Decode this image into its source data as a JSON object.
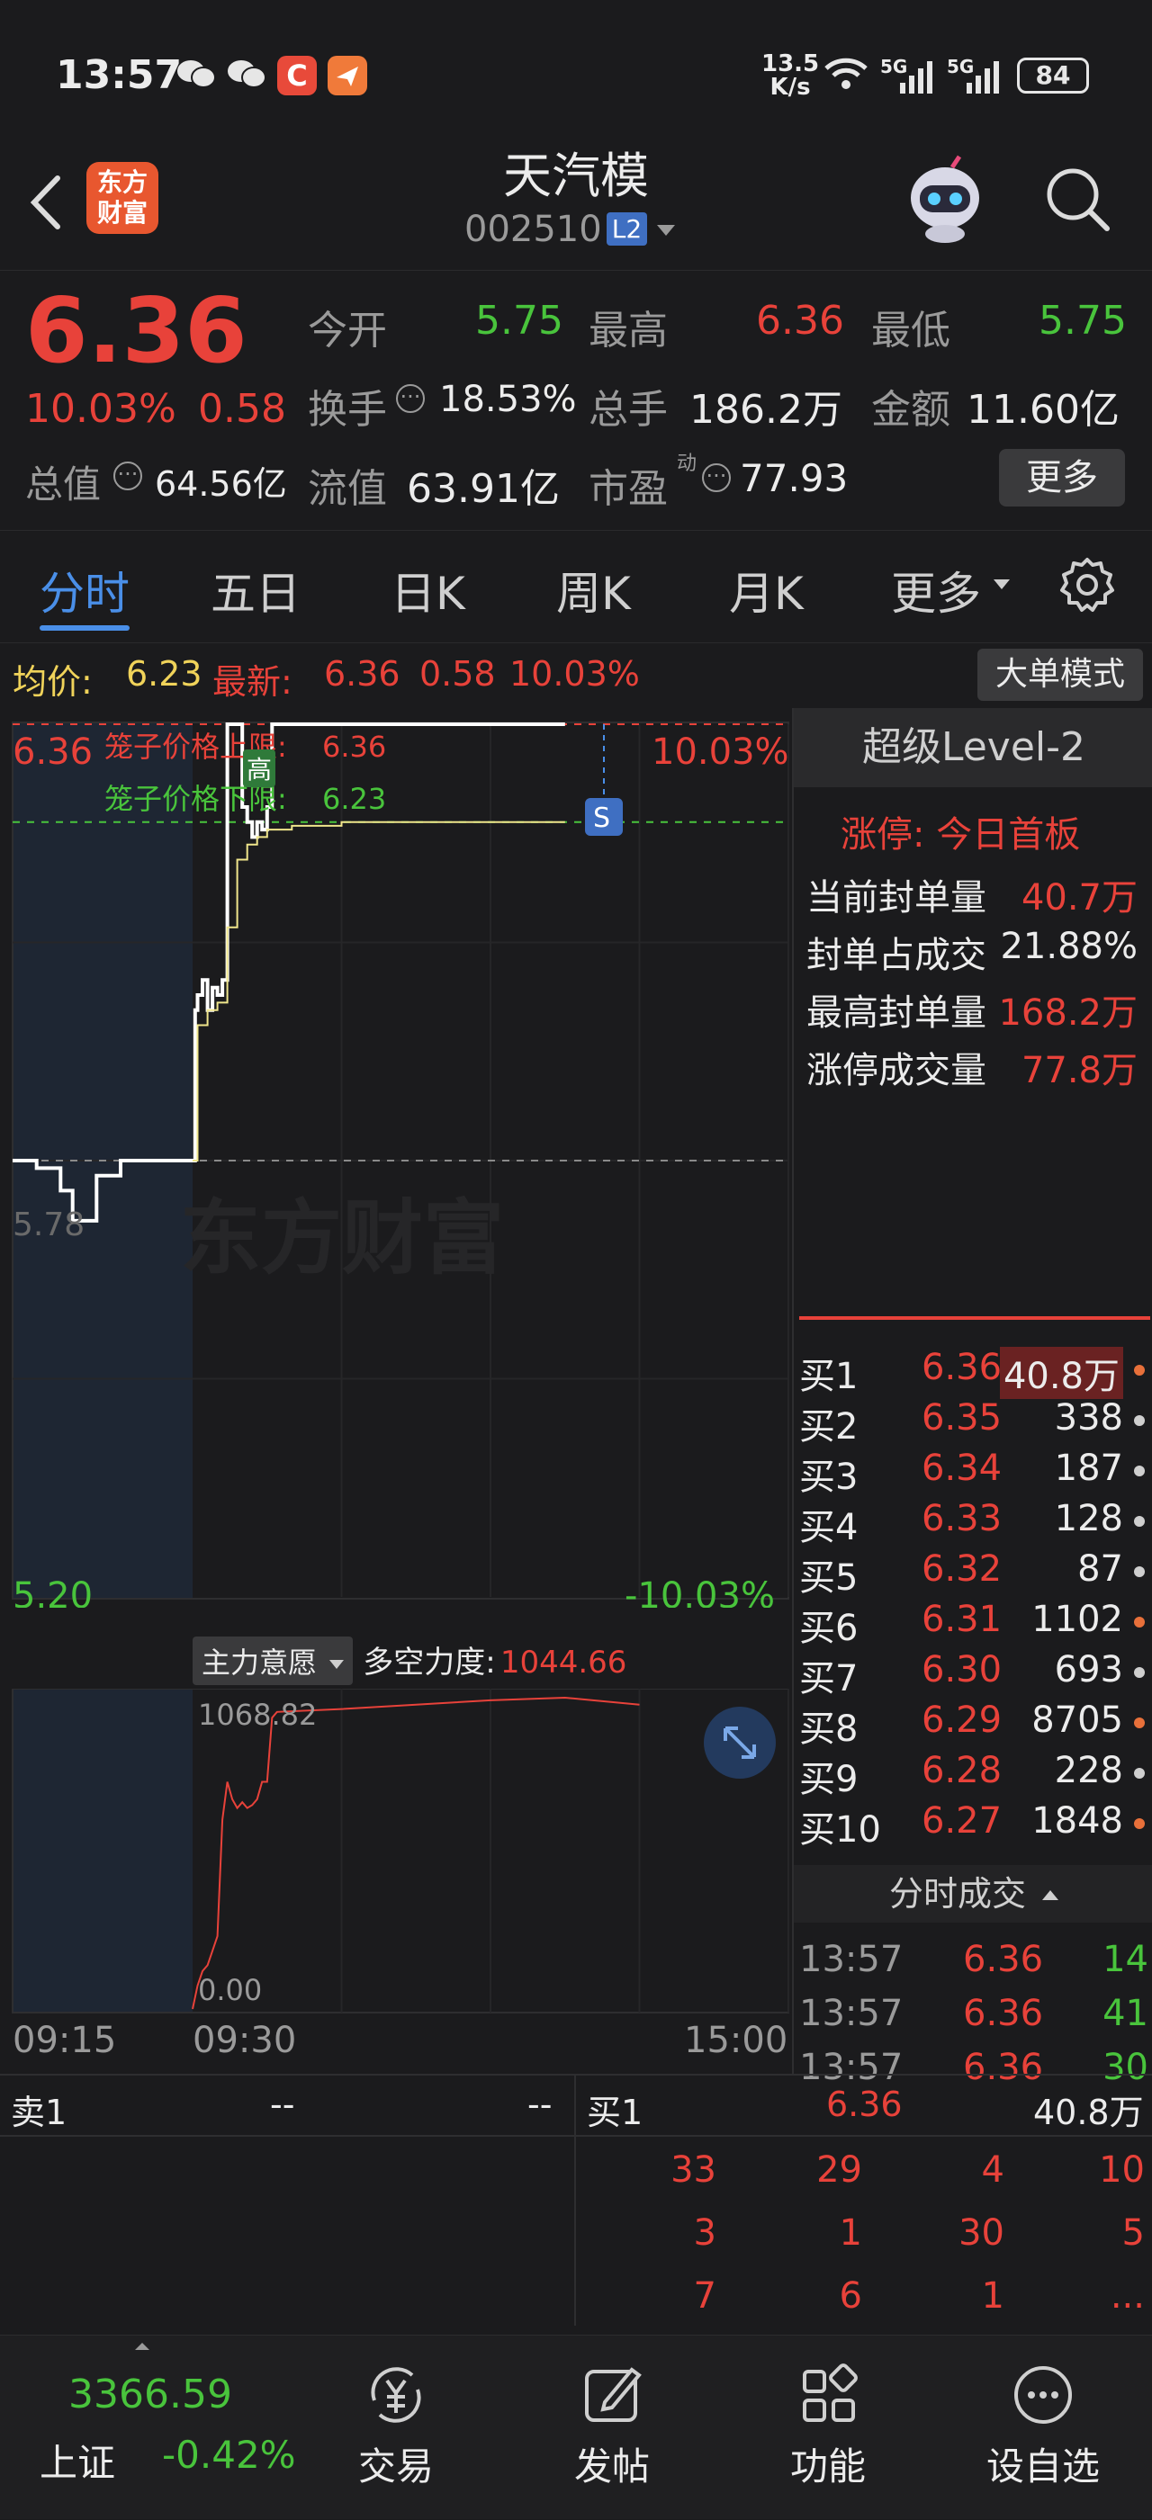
{
  "status_bar": {
    "time": "13:57",
    "net_speed_value": "13.5",
    "net_speed_unit": "K/s",
    "battery": "84",
    "signal1": "5G",
    "signal2": "5G"
  },
  "nav": {
    "logo_line1": "东方",
    "logo_line2": "财富",
    "title": "天汽模",
    "code": "002510",
    "level_badge": "L2"
  },
  "quote": {
    "price": "6.36",
    "change_pct": "10.03%",
    "change": "0.58",
    "fields": [
      {
        "label": "今开",
        "value": "5.75",
        "color": "green"
      },
      {
        "label": "最高",
        "value": "6.36",
        "color": "red"
      },
      {
        "label": "最低",
        "value": "5.75",
        "color": "green"
      },
      {
        "label": "换手",
        "value": "18.53%",
        "color": "white"
      },
      {
        "label": "总手",
        "value": "186.2万",
        "color": "white"
      },
      {
        "label": "金额",
        "value": "11.60亿",
        "color": "white"
      },
      {
        "label": "总值",
        "value": "64.56亿",
        "color": "white"
      },
      {
        "label": "流值",
        "value": "63.91亿",
        "color": "white"
      },
      {
        "label": "市盈",
        "value": "77.93",
        "color": "white"
      }
    ],
    "pe_superscript": "动",
    "more_button": "更多"
  },
  "tabs": {
    "items": [
      "分时",
      "五日",
      "日K",
      "周K",
      "月K",
      "更多"
    ],
    "active": "分时"
  },
  "chart_header": {
    "avg_label": "均价:",
    "avg_value": "6.23",
    "latest_label": "最新:",
    "latest_value": "6.36",
    "latest_change": "0.58",
    "latest_pct": "10.03%",
    "big_order_button": "大单模式"
  },
  "chart_labels": {
    "top_price": "6.36",
    "top_pct": "10.03%",
    "bottom_price": "5.20",
    "bottom_pct": "-10.03%",
    "ref_price": "5.78",
    "cage_upper_label": "笼子价格上限:",
    "cage_upper_value": "6.36",
    "cage_lower_label": "笼子价格下限:",
    "cage_lower_value": "6.23",
    "high_marker": "高",
    "s_marker": "S",
    "watermark": "东方财富"
  },
  "chart_data": [
    {
      "type": "line",
      "title": "分时",
      "ylim": [
        5.2,
        6.36
      ],
      "x_ticks": [
        "09:15",
        "09:30",
        "15:00"
      ],
      "series": [
        {
          "name": "最新",
          "x": [
            "09:15",
            "09:17",
            "09:19",
            "09:20",
            "09:22",
            "09:24",
            "09:25",
            "09:30",
            "09:31",
            "09:32",
            "09:34",
            "09:36",
            "09:38",
            "09:40",
            "09:42",
            "09:44",
            "09:46",
            "09:47",
            "09:48",
            "09:50",
            "09:52",
            "09:54",
            "09:56",
            "09:58",
            "10:00",
            "10:02",
            "10:04",
            "10:06",
            "10:08",
            "10:10",
            "10:30",
            "11:00",
            "11:30",
            "13:30"
          ],
          "y": [
            5.78,
            5.77,
            5.74,
            5.7,
            5.76,
            5.78,
            5.78,
            5.78,
            5.98,
            6.0,
            6.02,
            5.98,
            6.01,
            6.0,
            6.02,
            6.36,
            6.36,
            6.36,
            6.36,
            6.25,
            6.23,
            6.21,
            6.23,
            6.22,
            6.25,
            6.36,
            6.36,
            6.36,
            6.36,
            6.36,
            6.36,
            6.36,
            6.36,
            6.36
          ]
        },
        {
          "name": "均价",
          "x": [
            "09:30",
            "09:32",
            "09:36",
            "09:40",
            "09:44",
            "09:48",
            "09:52",
            "09:56",
            "10:00",
            "10:10",
            "10:30",
            "11:00",
            "11:30",
            "13:30"
          ],
          "y": [
            5.78,
            5.96,
            5.98,
            5.99,
            6.09,
            6.18,
            6.2,
            6.21,
            6.22,
            6.225,
            6.23,
            6.23,
            6.23,
            6.23
          ]
        }
      ]
    },
    {
      "type": "line",
      "title": "主力意愿",
      "ylim": [
        0.0,
        1068.82
      ],
      "series": [
        {
          "name": "多空力度",
          "x": [
            "09:30",
            "09:32",
            "09:34",
            "09:36",
            "09:38",
            "09:40",
            "09:42",
            "09:44",
            "09:46",
            "09:48",
            "09:50",
            "09:52",
            "09:54",
            "09:56",
            "09:58",
            "10:00",
            "10:02",
            "10:04",
            "10:30",
            "11:00",
            "11:30",
            "13:30",
            "14:00"
          ],
          "y": [
            0,
            80,
            130,
            150,
            200,
            250,
            650,
            780,
            720,
            690,
            710,
            690,
            700,
            720,
            780,
            780,
            1000,
            1020,
            1030,
            1045,
            1060,
            1068.82,
            1044.66
          ]
        }
      ]
    }
  ],
  "indicator": {
    "selector": "主力意愿",
    "label": "多空力度:",
    "value": "1044.66",
    "top_value": "1068.82",
    "bottom_value": "0.00"
  },
  "x_axis": {
    "t1": "09:15",
    "t2": "09:30",
    "t3": "15:00"
  },
  "level2": {
    "title": "超级Level-2",
    "limit_status": "涨停: 今日首板",
    "stats": [
      {
        "label": "当前封单量",
        "value": "40.7万",
        "color": "red"
      },
      {
        "label": "封单占成交",
        "value": "21.88%",
        "color": "white"
      },
      {
        "label": "最高封单量",
        "value": "168.2万",
        "color": "red"
      },
      {
        "label": "涨停成交量",
        "value": "77.8万",
        "color": "red"
      }
    ]
  },
  "order_book": [
    {
      "label": "买1",
      "price": "6.36",
      "volume": "40.8万",
      "dot": "#e8703a",
      "highlight": true
    },
    {
      "label": "买2",
      "price": "6.35",
      "volume": "338",
      "dot": "#cfcfcf"
    },
    {
      "label": "买3",
      "price": "6.34",
      "volume": "187",
      "dot": "#cfcfcf"
    },
    {
      "label": "买4",
      "price": "6.33",
      "volume": "128",
      "dot": "#cfcfcf"
    },
    {
      "label": "买5",
      "price": "6.32",
      "volume": "87",
      "dot": "#cfcfcf"
    },
    {
      "label": "买6",
      "price": "6.31",
      "volume": "1102",
      "dot": "#e8703a"
    },
    {
      "label": "买7",
      "price": "6.30",
      "volume": "693",
      "dot": "#cfcfcf"
    },
    {
      "label": "买8",
      "price": "6.29",
      "volume": "8705",
      "dot": "#e8703a"
    },
    {
      "label": "买9",
      "price": "6.28",
      "volume": "228",
      "dot": "#cfcfcf"
    },
    {
      "label": "买10",
      "price": "6.27",
      "volume": "1848",
      "dot": "#e8703a"
    }
  ],
  "trades": {
    "title": "分时成交",
    "rows": [
      {
        "time": "13:57",
        "price": "6.36",
        "vol": "14",
        "vol_color": "green"
      },
      {
        "time": "13:57",
        "price": "6.36",
        "vol": "41",
        "vol_color": "green"
      },
      {
        "time": "13:57",
        "price": "6.36",
        "vol": "30",
        "vol_color": "green"
      }
    ]
  },
  "bottom_book": {
    "sell_label": "卖1",
    "sell_price": "--",
    "sell_vol": "--",
    "buy_label": "买1",
    "buy_price": "6.36",
    "buy_vol": "40.8万",
    "queue": [
      [
        "33",
        "29",
        "4",
        "10"
      ],
      [
        "3",
        "1",
        "30",
        "5"
      ],
      [
        "7",
        "6",
        "1",
        "..."
      ]
    ]
  },
  "tabbar": {
    "index_value": "3366.59",
    "index_name": "上证",
    "index_change": "-0.42%",
    "items": [
      {
        "label": "交易",
        "icon": "yuan-cycle-icon"
      },
      {
        "label": "发帖",
        "icon": "edit-icon"
      },
      {
        "label": "功能",
        "icon": "grid-icon"
      },
      {
        "label": "设自选",
        "icon": "more-circle-icon"
      }
    ]
  }
}
